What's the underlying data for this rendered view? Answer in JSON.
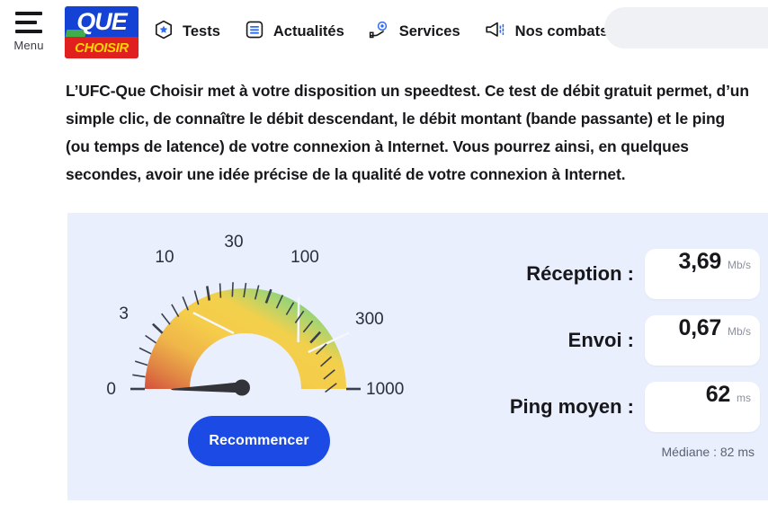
{
  "header": {
    "menu": {
      "label": "Menu",
      "icon": "hamburger-icon"
    },
    "logo": {
      "top_text": "QUE",
      "bottom_text": "CHOISIR"
    },
    "nav": [
      {
        "label": "Tests",
        "icon": "box-star-icon"
      },
      {
        "label": "Actualités",
        "icon": "list-document-icon"
      },
      {
        "label": "Services",
        "icon": "hand-gear-icon"
      },
      {
        "label": "Nos combats",
        "icon": "megaphone-icon"
      }
    ],
    "search": {
      "placeholder": ""
    }
  },
  "intro": {
    "paragraph": "L’UFC-Que Choisir met à votre disposition un speedtest. Ce test de débit gratuit permet, d’un simple clic, de connaître le débit descendant, le débit montant (bande passante) et le ping (ou temps de latence) de votre connexion à Internet. Vous pourrez ainsi, en quelques secondes, avoir une idée précise de la qualité de votre connexion à Internet."
  },
  "speedtest": {
    "restart_label": "Recommencer",
    "results": [
      {
        "label": "Réception :",
        "value": "3,69",
        "unit": "Mb/s"
      },
      {
        "label": "Envoi :",
        "value": "0,67",
        "unit": "Mb/s"
      },
      {
        "label": "Ping moyen :",
        "value": "62",
        "unit": "ms"
      }
    ],
    "median_note": "Médiane : 82 ms",
    "gauge": {
      "tick_labels": [
        "0",
        "3",
        "10",
        "30",
        "100",
        "300",
        "1000"
      ],
      "needle_value": "3,69",
      "colors": {
        "red": "#d4503c",
        "orange": "#efa948",
        "yellow": "#f5cd4a",
        "green": "#4ecb8c",
        "panel_bg": "#e9effd",
        "accent_blue": "#1b4ae5"
      }
    }
  }
}
